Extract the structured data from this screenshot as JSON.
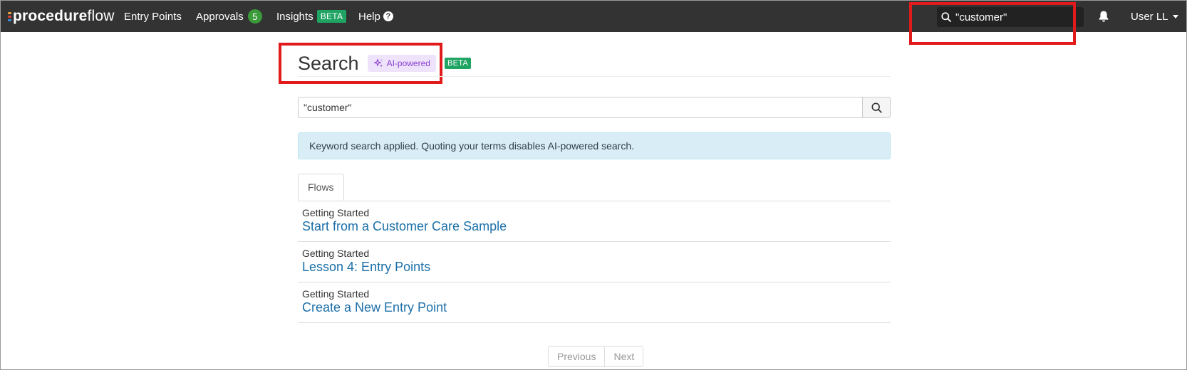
{
  "brand": {
    "name_bold": "procedure",
    "name_light": "flow"
  },
  "nav": {
    "entry_points": "Entry Points",
    "approvals": "Approvals",
    "approvals_count": "5",
    "insights": "Insights",
    "insights_badge": "BETA",
    "help": "Help",
    "help_icon": "?"
  },
  "header_search": {
    "value": "\"customer\""
  },
  "user_menu": {
    "label": "User LL"
  },
  "page": {
    "title": "Search",
    "ai_badge": "AI-powered",
    "beta_badge": "BETA"
  },
  "search": {
    "value": "\"customer\""
  },
  "alert": {
    "text": "Keyword search applied. Quoting your terms disables AI-powered search."
  },
  "tabs": [
    {
      "label": "Flows",
      "active": true
    }
  ],
  "results": [
    {
      "category": "Getting Started",
      "title": "Start from a Customer Care Sample"
    },
    {
      "category": "Getting Started",
      "title": "Lesson 4: Entry Points"
    },
    {
      "category": "Getting Started",
      "title": "Create a New Entry Point"
    }
  ],
  "pagination": {
    "previous": "Previous",
    "next": "Next"
  },
  "icons": {
    "search": "search-icon",
    "bell": "bell-icon",
    "sparkle": "sparkle-icon",
    "help": "question-circle-icon",
    "caret": "caret-down-icon"
  },
  "colors": {
    "navbar": "#333333",
    "count_badge": "#3b9b3b",
    "beta_badge": "#1fa463",
    "ai_badge_bg": "#efe3fb",
    "ai_badge_text": "#8a3fd1",
    "link": "#1b6fa8",
    "alert_bg": "#d9edf7",
    "highlight": "#e11b1b"
  }
}
